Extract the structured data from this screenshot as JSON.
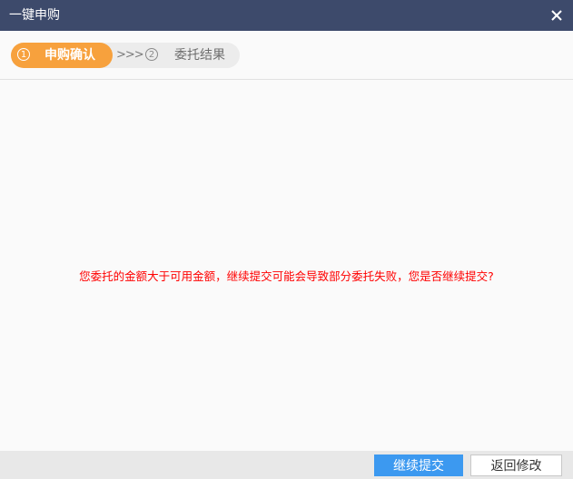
{
  "window": {
    "title": "一键申购",
    "close_icon": "close-icon"
  },
  "steps": [
    {
      "number": "1",
      "label": "申购确认",
      "active": true
    },
    {
      "number": "2",
      "label": "委托结果",
      "active": false
    }
  ],
  "steps_separator": ">>>",
  "message": "您委托的金额大于可用金额，继续提交可能会导致部分委托失败，您是否继续提交?",
  "buttons": {
    "continue": "继续提交",
    "back": "返回修改"
  },
  "colors": {
    "titlebar": "#3d4a6b",
    "step_active": "#f7a13d",
    "message": "#ff0000",
    "primary_button": "#3c99f0"
  }
}
